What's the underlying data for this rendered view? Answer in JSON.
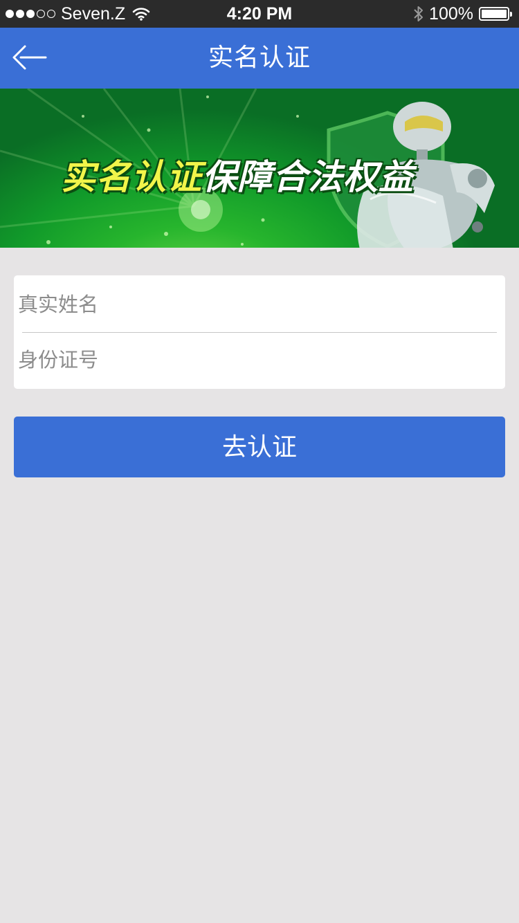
{
  "status_bar": {
    "carrier": "Seven.Z",
    "time": "4:20 PM",
    "battery_percent": "100%",
    "signal_bars_on": 3,
    "signal_bars_total": 5,
    "icons": [
      "signal-dots",
      "wifi-icon",
      "bluetooth-icon",
      "battery-icon"
    ]
  },
  "nav": {
    "title": "实名认证",
    "back_icon": "arrow-left-icon"
  },
  "banner": {
    "slogan_highlight": "实名认证",
    "slogan_rest": "保障合法权益",
    "colors": {
      "highlight": "#f2f54a",
      "rest": "#ffffff",
      "background": "#1fae2c"
    }
  },
  "form": {
    "name_placeholder": "真实姓名",
    "name_value": "",
    "id_placeholder": "身份证号",
    "id_value": ""
  },
  "submit": {
    "label": "去认证"
  },
  "theme": {
    "primary": "#3a6fd6",
    "page_background": "#e6e4e5",
    "status_bar": "#2b2b2b"
  }
}
